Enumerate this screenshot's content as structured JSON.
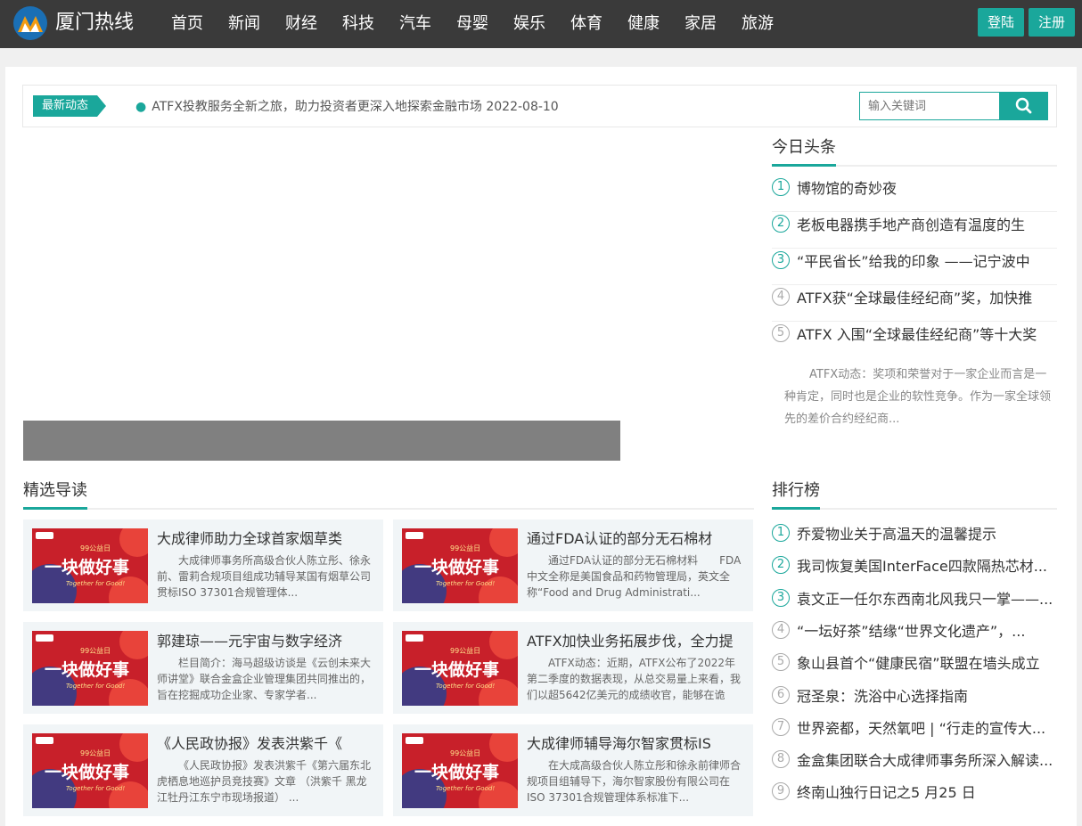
{
  "header": {
    "site_name": "厦门热线",
    "nav": [
      "首页",
      "新闻",
      "财经",
      "科技",
      "汽车",
      "母婴",
      "娱乐",
      "体育",
      "健康",
      "家居",
      "旅游"
    ],
    "login_label": "登陆",
    "register_label": "注册"
  },
  "announcement": {
    "tag": "最新动态",
    "text": "ATFX投教服务全新之旅，助力投资者更深入地探索金融市场 2022-08-10"
  },
  "search": {
    "placeholder": "输入关键词"
  },
  "today": {
    "title": "今日头条",
    "items": [
      {
        "num": "1",
        "text": "博物馆的奇妙夜"
      },
      {
        "num": "2",
        "text": "老板电器携手地产商创造有温度的生"
      },
      {
        "num": "3",
        "text": "“平民省长”给我的印象 ——记宁波中"
      },
      {
        "num": "4",
        "text": "ATFX获“全球最佳经纪商”奖，加快推"
      },
      {
        "num": "5",
        "text": "ATFX 入围“全球最佳经纪商”等十大奖"
      }
    ],
    "summary": "ATFX动态：奖项和荣誉对于一家企业而言是一种肯定，同时也是企业的软性竞争。作为一家全球领先的差价合约经纪商..."
  },
  "featured": {
    "title": "精选导读",
    "thumb_badge": "99公益日",
    "thumb_main": "一块做好事",
    "thumb_sub": "Together for Good!",
    "cards": [
      {
        "title": "大成律师助力全球首家烟草类",
        "desc": "大成律师事务所高级合伙人陈立彤、徐永前、雷莉合规项目组成功辅导某国有烟草公司贯标ISO 37301合规管理体..."
      },
      {
        "title": "通过FDA认证的部分无石棉材",
        "desc": "通过FDA认证的部分无石棉材料　　FDA中文全称是美国食品和药物管理局，英文全称“Food and Drug Administrati..."
      },
      {
        "title": "郭建琼——元宇宙与数字经济",
        "desc": "栏目简介：海马超级访谈是《云创未来大师讲堂》联合金盒企业管理集团共同推出的，旨在挖掘成功企业家、专家学者..."
      },
      {
        "title": "ATFX加快业务拓展步伐，全力提",
        "desc": "ATFX动态：近期，ATFX公布了2022年第二季度的数据表现，从总交易量上来看，我们以超5642亿美元的成绩收官，能够在诡谲..."
      },
      {
        "title": "《人民政协报》发表洪紫千《",
        "desc": "《人民政协报》发表洪紫千《第六届东北虎栖息地巡护员竞技赛》文章 （洪紫千 黑龙江牡丹江东宁市现场报道） ..."
      },
      {
        "title": "大成律师辅导海尔智家贯标IS",
        "desc": "在大成高级合伙人陈立彤和徐永前律师合规项目组辅导下，海尔智家股份有限公司在ISO 37301合规管理体系标准下..."
      }
    ]
  },
  "ranking": {
    "title": "排行榜",
    "items": [
      {
        "num": "1",
        "text": "乔爱物业关于高温天的温馨提示"
      },
      {
        "num": "2",
        "text": "我司恢复美国InterFace四款隔热芯材..."
      },
      {
        "num": "3",
        "text": "袁文正一任尔东西南北风我只一掌——..."
      },
      {
        "num": "4",
        "text": "“一坛好茶”结缘“世界文化遗产”，..."
      },
      {
        "num": "5",
        "text": "象山县首个“健康民宿”联盟在墙头成立"
      },
      {
        "num": "6",
        "text": "冠圣泉：洗浴中心选择指南"
      },
      {
        "num": "7",
        "text": "世界瓷都，天然氧吧 | “行走的宣传大..."
      },
      {
        "num": "8",
        "text": "金盒集团联合大成律师事务所深入解读..."
      },
      {
        "num": "9",
        "text": "终南山独行日记之5 月25 日"
      }
    ]
  },
  "colors": {
    "accent": "#1aa79b",
    "topbar": "#3a3a3a"
  }
}
